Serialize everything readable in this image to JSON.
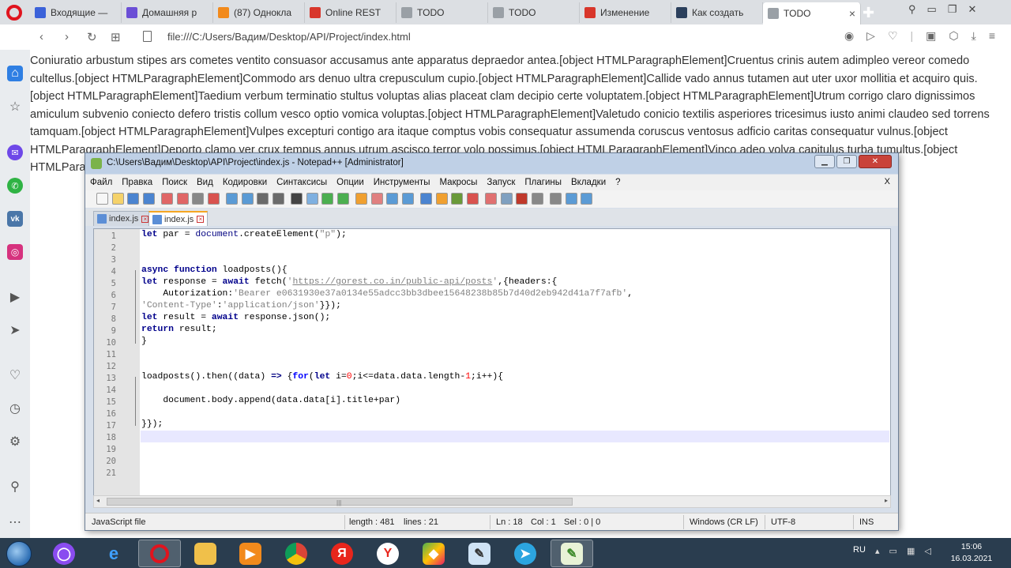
{
  "browser": {
    "tabs": [
      {
        "title": "Входящие —",
        "color": "#3b62d9"
      },
      {
        "title": "Домашняя р",
        "color": "#6b4fd6"
      },
      {
        "title": "(87) Однокла",
        "color": "#f28a1c"
      },
      {
        "title": "Online REST",
        "color": "#d8362b"
      },
      {
        "title": "TODO",
        "color": "#9aa0a6"
      },
      {
        "title": "TODO",
        "color": "#9aa0a6"
      },
      {
        "title": "Изменение",
        "color": "#d8362b"
      },
      {
        "title": "Как создать",
        "color": "#2b3f5c"
      },
      {
        "title": "TODO",
        "color": "#9aa0a6",
        "active": true
      }
    ],
    "url": "file:///C:/Users/Вадим/Desktop/API/Project/index.html"
  },
  "page": {
    "text": "Coniuratio arbustum stipes ars cometes ventito consuasor accusamus ante apparatus depraedor antea.[object HTMLParagraphElement]Cruentus crinis autem adimpleo vereor comedo cultellus.[object HTMLParagraphElement]Commodo ars denuo ultra crepusculum cupio.[object HTMLParagraphElement]Callide vado annus tutamen aut uter uxor mollitia et acquiro quis.[object HTMLParagraphElement]Taedium verbum terminatio stultus voluptas alias placeat clam decipio certe voluptatem.[object HTMLParagraphElement]Utrum corrigo claro dignissimos amiculum subvenio coniecto defero tristis collum vesco optio vomica voluptas.[object HTMLParagraphElement]Valetudo conicio textilis asperiores tricesimus iusto animi claudeo sed torrens tamquam.[object HTMLParagraphElement]Vulpes excepturi contigo ara itaque comptus vobis consequatur assumenda coruscus ventosus adficio caritas consequatur vulnus.[object HTMLParagraphElement]Deporto clamo ver crux tempus annus utrum ascisco terror volo possimus.[object HTMLParagraphElement]Vinco adeo volva capitulus turba tumultus.[object HTMLParagraphElement]"
  },
  "npp": {
    "title": "C:\\Users\\Вадим\\Desktop\\API\\Project\\index.js - Notepad++ [Administrator]",
    "menu": [
      "Файл",
      "Правка",
      "Поиск",
      "Вид",
      "Кодировки",
      "Синтаксисы",
      "Опции",
      "Инструменты",
      "Макросы",
      "Запуск",
      "Плагины",
      "Вкладки",
      "?"
    ],
    "menu_close": "X",
    "file_tabs": [
      "index.js",
      "index.js"
    ],
    "line_numbers": [
      "1",
      "2",
      "3",
      "4",
      "5",
      "6",
      "7",
      "8",
      "9",
      "10",
      "11",
      "12",
      "13",
      "14",
      "15",
      "16",
      "17",
      "18",
      "19",
      "20",
      "21"
    ],
    "status": {
      "lang": "JavaScript file",
      "length": "length : 481",
      "lines": "lines : 21",
      "ln": "Ln : 18",
      "col": "Col : 1",
      "sel": "Sel : 0 | 0",
      "eol": "Windows (CR LF)",
      "enc": "UTF-8",
      "mode": "INS"
    },
    "code": {
      "l1": {
        "a": "let",
        "b": " par = ",
        "c": "document",
        "d": ".createElement(",
        "e": "\"p\"",
        "f": ");"
      },
      "l4": {
        "a": "async",
        "b": " ",
        "c": "function",
        "d": " loadposts(){"
      },
      "l5": {
        "a": "let",
        "b": " response = ",
        "c": "await",
        "d": " fetch(",
        "e": "'",
        "f": "https://gorest.co.in/public-api/posts",
        "g": "'",
        "h": ",{headers:{"
      },
      "l6": {
        "a": "    Autorization:",
        "b": "'Bearer e0631930e37a0134e55adcc3bb3dbee15648238b85b7d40d2eb942d41a7f7afb'",
        "c": ","
      },
      "l7": {
        "a": "'Content-Type'",
        "b": ":",
        "c": "'application/json'",
        "d": "}});"
      },
      "l8": {
        "a": "let",
        "b": " result = ",
        "c": "await",
        "d": " response.json();"
      },
      "l9": {
        "a": "return",
        "b": " result;"
      },
      "l10": {
        "a": "}"
      },
      "l13": {
        "a": "loadposts().then((data) ",
        "b": "=>",
        "c": " {",
        "d": "for",
        "e": "(",
        "f": "let",
        "g": " i=",
        "h": "0",
        "i": ";i<=data.data.length-",
        "j": "1",
        "k": ";i++){"
      },
      "l15": {
        "a": "    document.body.append(data.data[i].title+par)"
      },
      "l17": {
        "a": "}});"
      }
    }
  },
  "taskbar": {
    "lang": "RU",
    "time": "15:06",
    "date": "16.03.2021"
  }
}
